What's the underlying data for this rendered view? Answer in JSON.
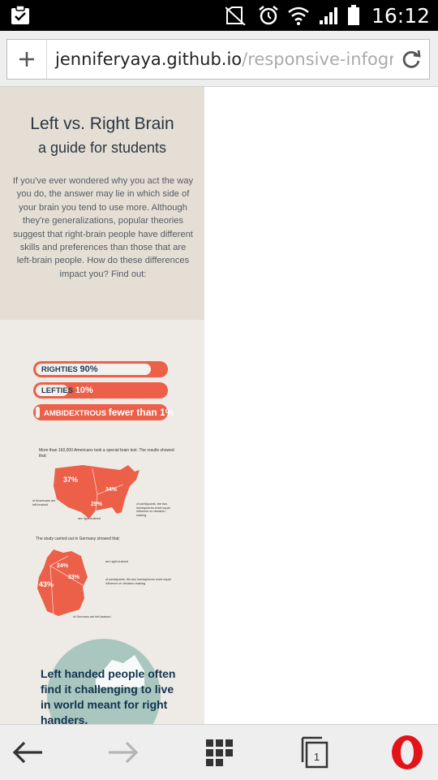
{
  "status_bar": {
    "time": "16:12",
    "icons": [
      "clipboard-check-icon",
      "no-sim-icon",
      "alarm-icon",
      "wifi-icon",
      "signal-icon",
      "battery-icon"
    ]
  },
  "address_bar": {
    "domain": "jenniferyaya.github.io",
    "path": "/responsive-infographi",
    "icons": [
      "plus-icon",
      "reload-icon"
    ]
  },
  "infographic": {
    "title": "Left vs. Right Brain",
    "subtitle": "a guide for students",
    "intro": "If you've ever wondered why you act the way you do, the answer may lie in which side of your brain you tend to use more. Although they're generalizations, popular theories suggest that right-brain people have different skills and preferences than those that are left-brain people. How do these differences impact you? Find out:",
    "bars": [
      {
        "label": "RIGHTIES",
        "value": "90%",
        "fraction": 0.9
      },
      {
        "label": "LEFTIES",
        "value": "10%",
        "fraction": 0.1
      },
      {
        "label": "AMBIDEXTROUS",
        "value": "fewer than 1%",
        "fraction": 0.01
      }
    ],
    "usa": {
      "caption": "More than 160,000 Americans took a special brain test. The results showed that:",
      "slices": [
        "37%",
        "34%",
        "29%"
      ],
      "note_left": "of Americans are left-brained",
      "note_right": "of participants, the two hemispheres exert equal influence on decision-making",
      "note_bottom": "are right-brained"
    },
    "germany": {
      "caption": "The study carried out in Germany showed that:",
      "slices": [
        "24%",
        "33%",
        "43%"
      ],
      "note_top": "are right-brained",
      "note_mid": "of participants, the two hemispheres exert equal influence on decision-making",
      "note_bottom": "of Germans are left-brained"
    },
    "circle_text": "Left handed people often find it challenging to live in world meant for right handers.",
    "colors": {
      "coral": "#ec5f48",
      "navy": "#1f3a55",
      "intro_bg": "#e5ded5",
      "page_bg": "#eeebe6",
      "circle": "#a9c7bf"
    }
  },
  "nav_bar": {
    "tab_count": "1",
    "icons": [
      "back-arrow-icon",
      "forward-arrow-icon",
      "speed-dial-grid-icon",
      "tabs-icon",
      "opera-menu-icon"
    ]
  }
}
